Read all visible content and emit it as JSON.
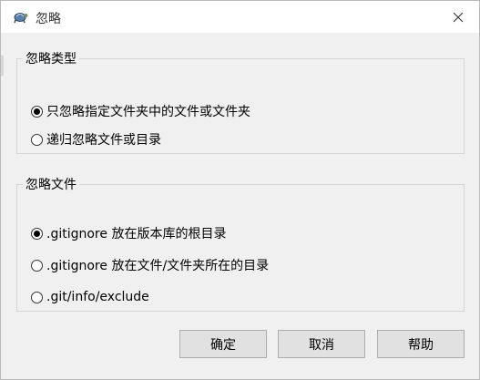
{
  "window": {
    "title": "忽略",
    "icon": "tortoise-icon"
  },
  "ignore_type": {
    "legend": "忽略类型",
    "options": [
      {
        "label": "只忽略指定文件夹中的文件或文件夹",
        "checked": true
      },
      {
        "label": "递归忽略文件或目录",
        "checked": false
      }
    ]
  },
  "ignore_file": {
    "legend": "忽略文件",
    "options": [
      {
        "label": ".gitignore 放在版本库的根目录",
        "checked": true
      },
      {
        "label": ".gitignore 放在文件/文件夹所在的目录",
        "checked": false
      },
      {
        "label": ".git/info/exclude",
        "checked": false
      }
    ]
  },
  "buttons": {
    "ok": "确定",
    "cancel": "取消",
    "help": "帮助"
  }
}
